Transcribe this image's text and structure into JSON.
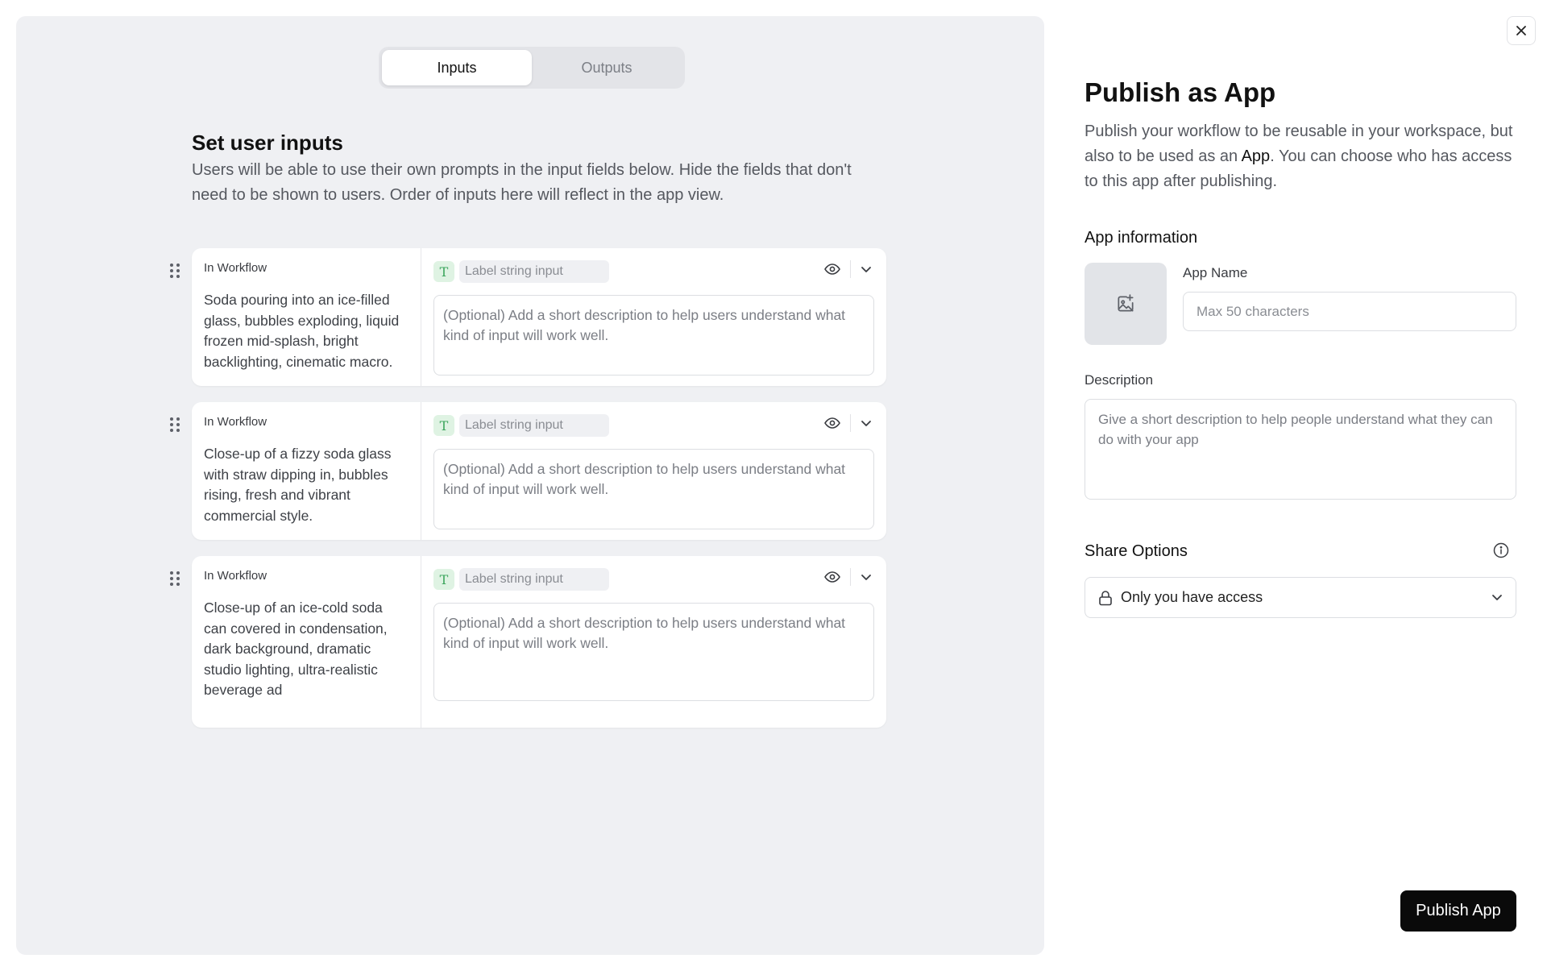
{
  "tabs": [
    {
      "label": "Inputs",
      "active": true
    },
    {
      "label": "Outputs",
      "active": false
    }
  ],
  "section": {
    "title": "Set user inputs",
    "description": "Users will be able to use their own prompts in the input fields below. Hide the fields that don't need to be shown to users. Order of inputs here will reflect in the app view."
  },
  "inputs": [
    {
      "source": "In Workflow",
      "prompt": "Soda pouring into an ice-filled glass, bubbles exploding, liquid frozen mid-splash, bright backlighting, cinematic macro.",
      "type_icon": "T",
      "label_placeholder": "Label string input",
      "description_placeholder": "(Optional) Add a short description to help users understand what kind of input will work well."
    },
    {
      "source": "In Workflow",
      "prompt": "Close-up of a fizzy soda glass with straw dipping in, bubbles rising, fresh and vibrant commercial style.",
      "type_icon": "T",
      "label_placeholder": "Label string input",
      "description_placeholder": "(Optional) Add a short description to help users understand what kind of input will work well."
    },
    {
      "source": "In Workflow",
      "prompt": "Close-up of an ice-cold soda can covered in condensation, dark background, dramatic studio lighting, ultra-realistic beverage ad",
      "type_icon": "T",
      "label_placeholder": "Label string input",
      "description_placeholder": "(Optional) Add a short description to help users understand what kind of input will work well."
    }
  ],
  "publish": {
    "title": "Publish as App",
    "description_before": "Publish your workflow to be reusable in your workspace, but also to be used as an ",
    "description_highlight": "App",
    "description_after": ". You can choose who has access to this app after publishing.",
    "app_info_heading": "App information",
    "app_name_label": "App Name",
    "app_name_placeholder": "Max 50 characters",
    "description_label": "Description",
    "description_placeholder": "Give a short description to help people understand what they can do with your app",
    "share_heading": "Share Options",
    "share_value": "Only you have access",
    "publish_button": "Publish App"
  },
  "colors": {
    "panel_bg": "#eff0f3",
    "type_badge_bg": "#dff3e3",
    "type_badge_fg": "#3ba55c",
    "primary_button": "#0a0a0a"
  },
  "icons": [
    "drag-handle-icon",
    "text-type-icon",
    "eye-icon",
    "chevron-down-icon",
    "close-icon",
    "image-add-icon",
    "info-icon",
    "lock-icon"
  ]
}
